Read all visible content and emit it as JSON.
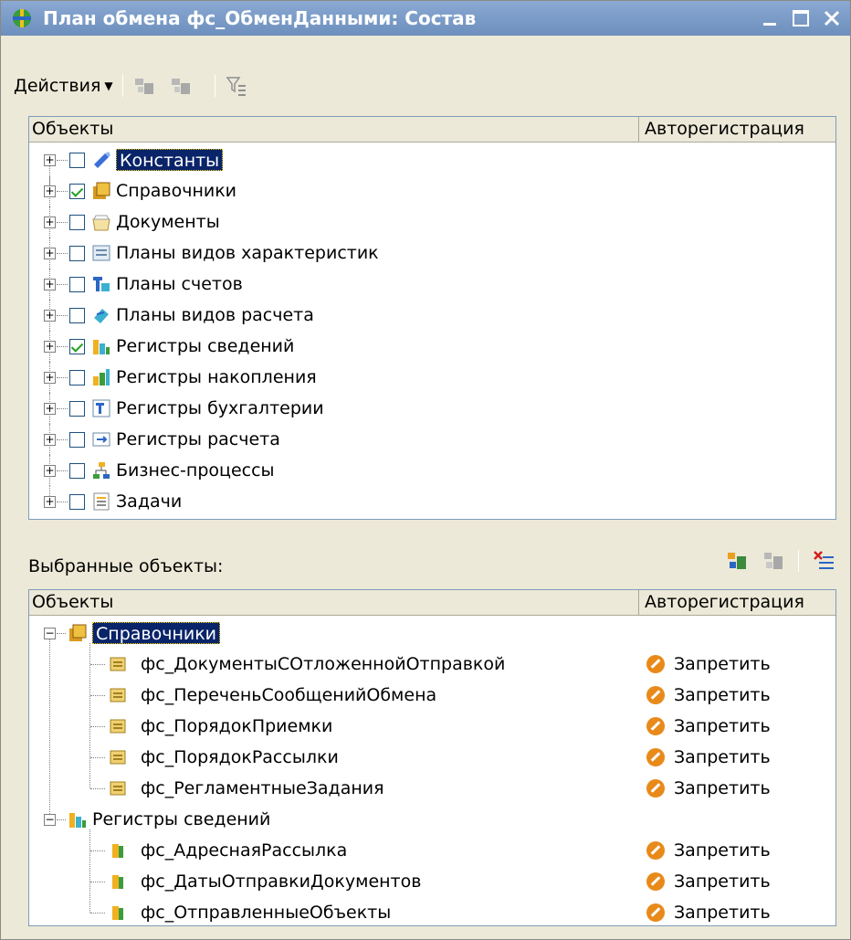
{
  "window": {
    "title": "План обмена фс_ОбменДанными: Состав"
  },
  "toolbar": {
    "actions_label": "Действия"
  },
  "top_table": {
    "col_objects": "Объекты",
    "col_autoreg": "Авторегистрация",
    "rows": [
      {
        "label": "Константы",
        "checked": false,
        "selected": true,
        "icon": "constants-icon"
      },
      {
        "label": "Справочники",
        "checked": true,
        "selected": false,
        "icon": "catalogs-icon"
      },
      {
        "label": "Документы",
        "checked": false,
        "selected": false,
        "icon": "documents-icon"
      },
      {
        "label": "Планы видов характеристик",
        "checked": false,
        "selected": false,
        "icon": "characteristic-types-icon"
      },
      {
        "label": "Планы счетов",
        "checked": false,
        "selected": false,
        "icon": "charts-of-accounts-icon"
      },
      {
        "label": "Планы видов расчета",
        "checked": false,
        "selected": false,
        "icon": "calculation-types-icon"
      },
      {
        "label": "Регистры сведений",
        "checked": true,
        "selected": false,
        "icon": "information-registers-icon"
      },
      {
        "label": "Регистры накопления",
        "checked": false,
        "selected": false,
        "icon": "accumulation-registers-icon"
      },
      {
        "label": "Регистры бухгалтерии",
        "checked": false,
        "selected": false,
        "icon": "accounting-registers-icon"
      },
      {
        "label": "Регистры расчета",
        "checked": false,
        "selected": false,
        "icon": "calculation-registers-icon"
      },
      {
        "label": "Бизнес-процессы",
        "checked": false,
        "selected": false,
        "icon": "business-processes-icon"
      },
      {
        "label": "Задачи",
        "checked": false,
        "selected": false,
        "icon": "tasks-icon"
      }
    ]
  },
  "selected_section": {
    "label": "Выбранные объекты:"
  },
  "bottom_table": {
    "col_objects": "Объекты",
    "col_autoreg": "Авторегистрация",
    "groups": [
      {
        "label": "Справочники",
        "items": [
          {
            "label": "фс_ДокументыСОтложеннойОтправкой",
            "autoreg": "Запретить"
          },
          {
            "label": "фс_ПереченьСообщенийОбмена",
            "autoreg": "Запретить"
          },
          {
            "label": "фс_ПорядокПриемки",
            "autoreg": "Запретить"
          },
          {
            "label": "фс_ПорядокРассылки",
            "autoreg": "Запретить"
          },
          {
            "label": "фс_РегламентныеЗадания",
            "autoreg": "Запретить"
          }
        ]
      },
      {
        "label": "Регистры сведений",
        "items": [
          {
            "label": "фс_АдреснаяРассылка",
            "autoreg": "Запретить"
          },
          {
            "label": "фс_ДатыОтправкиДокументов",
            "autoreg": "Запретить"
          },
          {
            "label": "фс_ОтправленныеОбъекты",
            "autoreg": "Запретить"
          }
        ]
      }
    ]
  },
  "colors": {
    "selection_bg": "#0a246a",
    "forbid_icon": "#e88a1a",
    "title_bar": "#7898c6"
  }
}
